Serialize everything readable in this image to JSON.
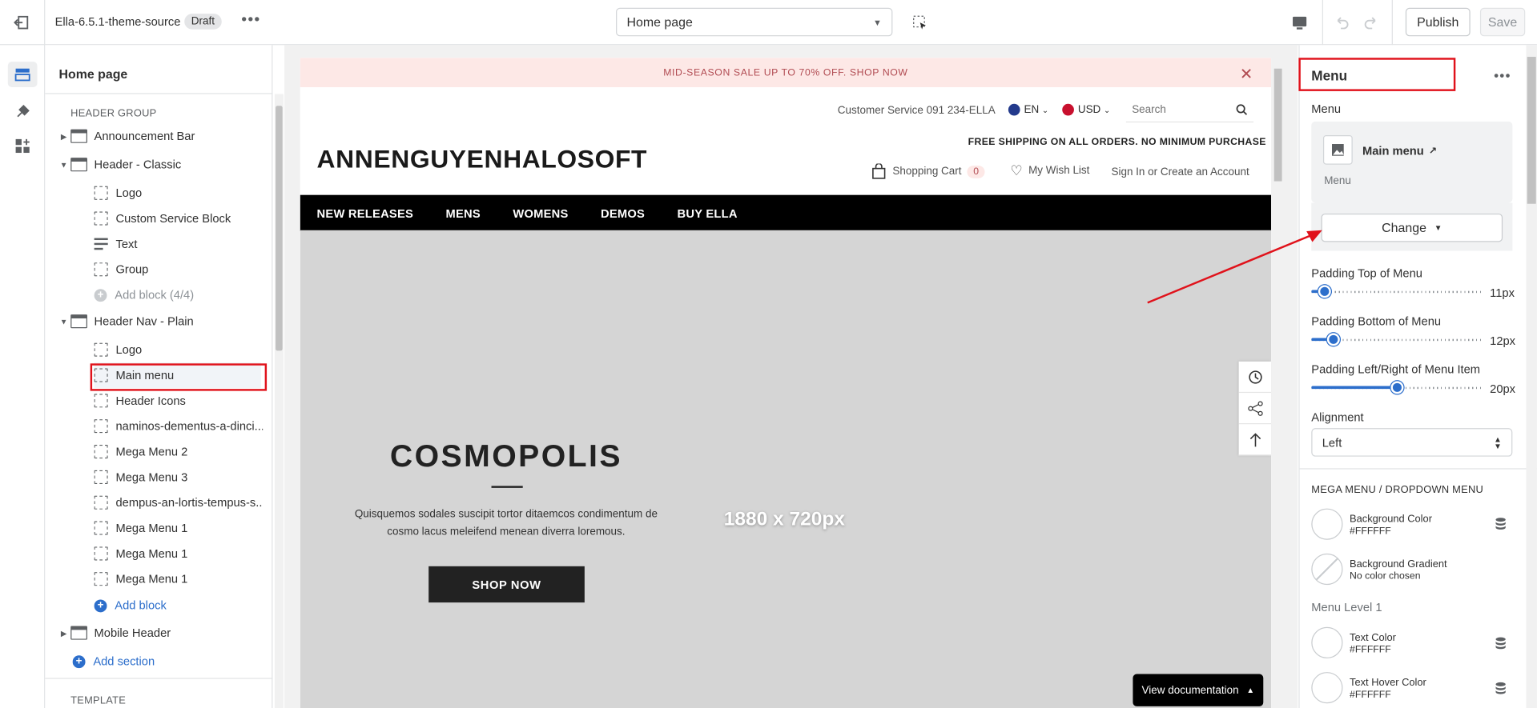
{
  "topbar": {
    "theme_name": "Ella-6.5.1-theme-source",
    "status_badge": "Draft",
    "page_select": "Home page",
    "publish_label": "Publish",
    "save_label": "Save"
  },
  "left": {
    "title": "Home page",
    "header_group_label": "HEADER GROUP",
    "sections": {
      "announcement": "Announcement Bar",
      "header_classic": "Header - Classic",
      "header_nav": "Header Nav - Plain",
      "mobile_header": "Mobile Header"
    },
    "classic_blocks": [
      "Logo",
      "Custom Service Block",
      "Text",
      "Group"
    ],
    "classic_add": "Add block (4/4)",
    "nav_blocks": [
      "Logo",
      "Main menu",
      "Header Icons",
      "naminos-dementus-a-dinci...",
      "Mega Menu 2",
      "Mega Menu 3",
      "dempus-an-lortis-tempus-s...",
      "Mega Menu 1",
      "Mega Menu 1",
      "Mega Menu 1"
    ],
    "nav_add": "Add block",
    "add_section": "Add section",
    "template_label": "TEMPLATE"
  },
  "preview": {
    "announcement": "MID-SEASON SALE UP TO 70% OFF. SHOP NOW",
    "customer_service": "Customer Service 091 234-ELLA",
    "lang": "EN",
    "currency": "USD",
    "search_placeholder": "Search",
    "logo": "ANNENGUYENHALOSOFT",
    "free_shipping": "FREE SHIPPING ON ALL ORDERS. NO MINIMUM PURCHASE",
    "cart_label": "Shopping Cart",
    "cart_count": "0",
    "wishlist": "My Wish List",
    "account": "Sign In or Create an Account",
    "nav": [
      "NEW RELEASES",
      "MENS",
      "WOMENS",
      "DEMOS",
      "BUY ELLA"
    ],
    "hero_title": "COSMOPOLIS",
    "hero_text": "Quisquemos sodales suscipit tortor ditaemcos condimentum de cosmo lacus meleifend menean diverra loremous.",
    "hero_button": "SHOP NOW",
    "hero_size": "1880 x 720px",
    "view_docs": "View documentation"
  },
  "right": {
    "title": "Menu",
    "menu_label": "Menu",
    "menu_name": "Main menu",
    "menu_sub": "Menu",
    "change_label": "Change",
    "padding_top_label": "Padding Top of Menu",
    "padding_top_value": "11px",
    "padding_top_fraction": 0.08,
    "padding_bottom_label": "Padding Bottom of Menu",
    "padding_bottom_value": "12px",
    "padding_bottom_fraction": 0.13,
    "padding_lr_label": "Padding Left/Right of Menu Item",
    "padding_lr_value": "20px",
    "padding_lr_fraction": 0.5,
    "alignment_label": "Alignment",
    "alignment_value": "Left",
    "mega_header": "MEGA MENU / DROPDOWN MENU",
    "bg_color_label": "Background Color",
    "bg_color_value": "#FFFFFF",
    "bg_gradient_label": "Background Gradient",
    "bg_gradient_value": "No color chosen",
    "level1_label": "Menu Level 1",
    "text_color_label": "Text Color",
    "text_color_value": "#FFFFFF",
    "text_hover_label": "Text Hover Color",
    "text_hover_value": "#FFFFFF"
  },
  "colors": {
    "accent": "#2c6ecb",
    "highlight": "#e0121b",
    "announce_bg": "#fde8e6",
    "nav_bg": "#000000",
    "hero_bg": "#d5d5d5"
  }
}
